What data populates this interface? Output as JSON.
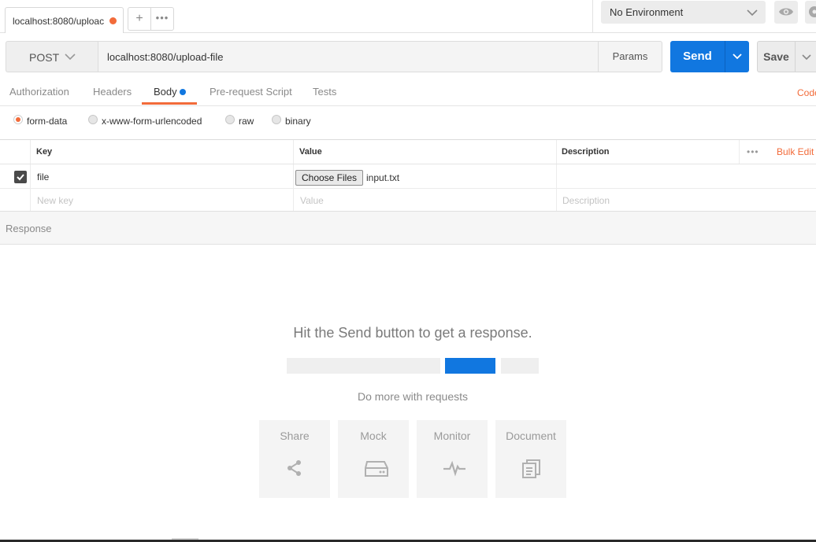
{
  "tabbar": {
    "active_tab": "localhost:8080/uploac",
    "add_label": "+",
    "more_label": "•••"
  },
  "environment": {
    "selected": "No Environment"
  },
  "request": {
    "method": "POST",
    "url": "localhost:8080/upload-file",
    "params_label": "Params",
    "send_label": "Send",
    "save_label": "Save"
  },
  "request_tabs": {
    "items": [
      "Authorization",
      "Headers",
      "Body",
      "Pre-request Script",
      "Tests"
    ],
    "active": "Body",
    "code_label": "Code"
  },
  "body_types": {
    "items": [
      "form-data",
      "x-www-form-urlencoded",
      "raw",
      "binary"
    ],
    "selected": "form-data"
  },
  "table": {
    "headers": {
      "key": "Key",
      "value": "Value",
      "description": "Description"
    },
    "more_label": "•••",
    "bulk_edit_label": "Bulk Edit",
    "rows": [
      {
        "checked": true,
        "key": "file",
        "button": "Choose Files",
        "value": "input.txt",
        "description": ""
      }
    ],
    "new_row": {
      "key": "New key",
      "value": "Value",
      "description": "Description"
    }
  },
  "response": {
    "label": "Response",
    "hint": "Hit the Send button to get a response.",
    "do_more": "Do more with requests",
    "cards": [
      {
        "label": "Share",
        "icon": "share-icon"
      },
      {
        "label": "Mock",
        "icon": "mock-server-icon"
      },
      {
        "label": "Monitor",
        "icon": "monitor-pulse-icon"
      },
      {
        "label": "Document",
        "icon": "document-icon"
      }
    ]
  },
  "colors": {
    "accent": "#f26b3a",
    "primary": "#1177e0"
  }
}
